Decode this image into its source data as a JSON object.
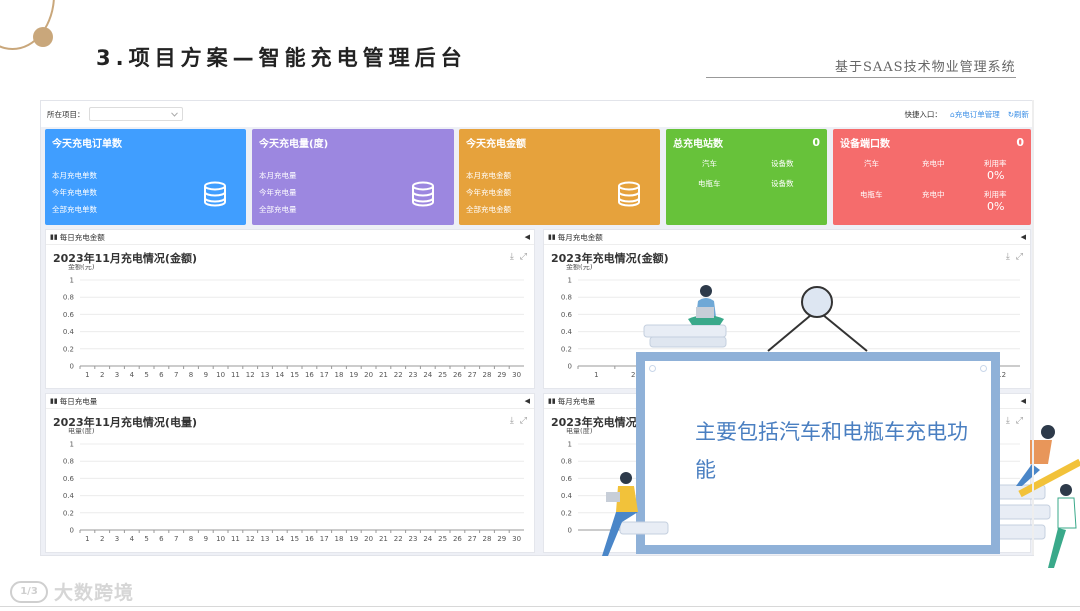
{
  "slide": {
    "title": "3.项目方案—智能充电管理后台",
    "subtitle": "基于SAAS技术物业管理系统",
    "logo_text": "大数跨境"
  },
  "topbar": {
    "project_label": "所在项目：",
    "project_value": "",
    "quick_label": "快捷入口：",
    "quick_order": "充电订单管理",
    "refresh": "刷新"
  },
  "cards": {
    "orders": {
      "title": "今天充电订单数",
      "rows": [
        "本月充电单数",
        "今年充电单数",
        "全部充电单数"
      ]
    },
    "energy": {
      "title": "今天充电量(度)",
      "rows": [
        "本月充电量",
        "今年充电量",
        "全部充电量"
      ]
    },
    "amount": {
      "title": "今天充电金额",
      "rows": [
        "本月充电金额",
        "今年充电金额",
        "全部充电金额"
      ]
    },
    "stations": {
      "title": "总充电站数",
      "value": "0",
      "car": "汽车",
      "ebike": "电瓶车",
      "device_count": "设备数"
    },
    "ports": {
      "title": "设备端口数",
      "value": "0",
      "car": "汽车",
      "ebike": "电瓶车",
      "charging": "充电中",
      "usage": "利用率",
      "car_pct": "0%",
      "ebike_pct": "0%"
    }
  },
  "panels": {
    "daily_amount": {
      "tab": "每日充电金额",
      "title": "2023年11月充电情况(金额)",
      "unit": "金额(元)"
    },
    "monthly_amount": {
      "tab": "每月充电金额",
      "title": "2023年充电情况(金额)",
      "unit": "金额(元)"
    },
    "daily_energy": {
      "tab": "每日充电量",
      "title": "2023年11月充电情况(电量)",
      "unit": "电量(度)"
    },
    "monthly_energy": {
      "tab": "每月充电量",
      "title": "2023年充电情况(",
      "unit": "电量(度)"
    }
  },
  "chart_data": [
    {
      "type": "bar",
      "title": "2023年11月充电情况(金额)",
      "ylabel": "金额(元)",
      "ylim": [
        0,
        1
      ],
      "yticks": [
        "0",
        "0.2",
        "0.4",
        "0.6",
        "0.8",
        "1"
      ],
      "categories": [
        "1",
        "2",
        "3",
        "4",
        "5",
        "6",
        "7",
        "8",
        "9",
        "10",
        "11",
        "12",
        "13",
        "14",
        "15",
        "16",
        "17",
        "18",
        "19",
        "20",
        "21",
        "22",
        "23",
        "24",
        "25",
        "26",
        "27",
        "28",
        "29",
        "30"
      ],
      "values": [
        0,
        0,
        0,
        0,
        0,
        0,
        0,
        0,
        0,
        0,
        0,
        0,
        0,
        0,
        0,
        0,
        0,
        0,
        0,
        0,
        0,
        0,
        0,
        0,
        0,
        0,
        0,
        0,
        0,
        0
      ]
    },
    {
      "type": "bar",
      "title": "2023年充电情况(金额)",
      "ylabel": "金额(元)",
      "ylim": [
        0,
        1
      ],
      "yticks": [
        "0",
        "0.2",
        "0.4",
        "0.6",
        "0.8",
        "1"
      ],
      "categories": [
        "1",
        "2",
        "3",
        "4",
        "5",
        "6",
        "7",
        "8",
        "9",
        "10",
        "11",
        "12"
      ],
      "values": [
        0,
        0,
        0,
        0,
        0,
        0,
        0,
        0,
        0,
        0,
        0,
        0
      ]
    },
    {
      "type": "bar",
      "title": "2023年11月充电情况(电量)",
      "ylabel": "电量(度)",
      "ylim": [
        0,
        1
      ],
      "yticks": [
        "0",
        "0.2",
        "0.4",
        "0.6",
        "0.8",
        "1"
      ],
      "categories": [
        "1",
        "2",
        "3",
        "4",
        "5",
        "6",
        "7",
        "8",
        "9",
        "10",
        "11",
        "12",
        "13",
        "14",
        "15",
        "16",
        "17",
        "18",
        "19",
        "20",
        "21",
        "22",
        "23",
        "24",
        "25",
        "26",
        "27",
        "28",
        "29",
        "30"
      ],
      "values": [
        0,
        0,
        0,
        0,
        0,
        0,
        0,
        0,
        0,
        0,
        0,
        0,
        0,
        0,
        0,
        0,
        0,
        0,
        0,
        0,
        0,
        0,
        0,
        0,
        0,
        0,
        0,
        0,
        0,
        0
      ]
    },
    {
      "type": "bar",
      "title": "2023年充电情况(",
      "ylabel": "电量(度)",
      "ylim": [
        0,
        1
      ],
      "yticks": [
        "0",
        "0.2",
        "0.4",
        "0.6",
        "0.8",
        "1"
      ],
      "categories": [],
      "values": []
    }
  ],
  "note": {
    "text": "主要包括汽车和电瓶车充电功能"
  },
  "colors": {
    "blue": "#409eff",
    "purple": "#9c87e0",
    "orange": "#e6a23c",
    "green": "#67c23a",
    "red": "#f56c6c",
    "note_border": "#8fb1d8"
  }
}
